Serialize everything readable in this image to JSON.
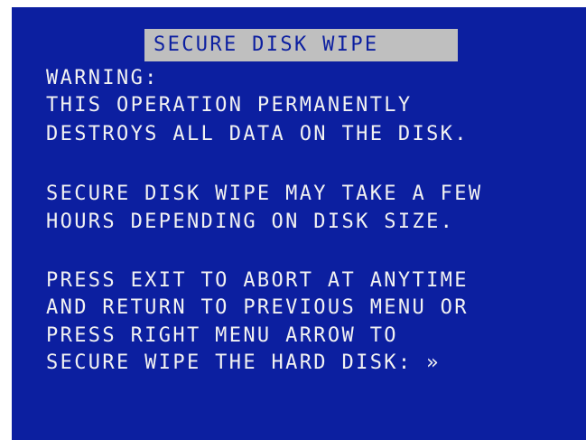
{
  "title": "SECURE DISK WIPE",
  "lines": [
    "WARNING:",
    "THIS OPERATION PERMANENTLY",
    "DESTROYS ALL DATA ON THE DISK.",
    "SECURE DISK WIPE MAY TAKE A FEW",
    "HOURS DEPENDING ON DISK SIZE.",
    "PRESS EXIT TO ABORT AT ANYTIME",
    "AND RETURN TO PREVIOUS MENU OR",
    "PRESS RIGHT MENU ARROW TO",
    "SECURE WIPE THE HARD DISK: »"
  ],
  "colors": {
    "background": "#0c1fa0",
    "text": "#f2f2f2",
    "title_highlight": "#bfbfbf"
  }
}
